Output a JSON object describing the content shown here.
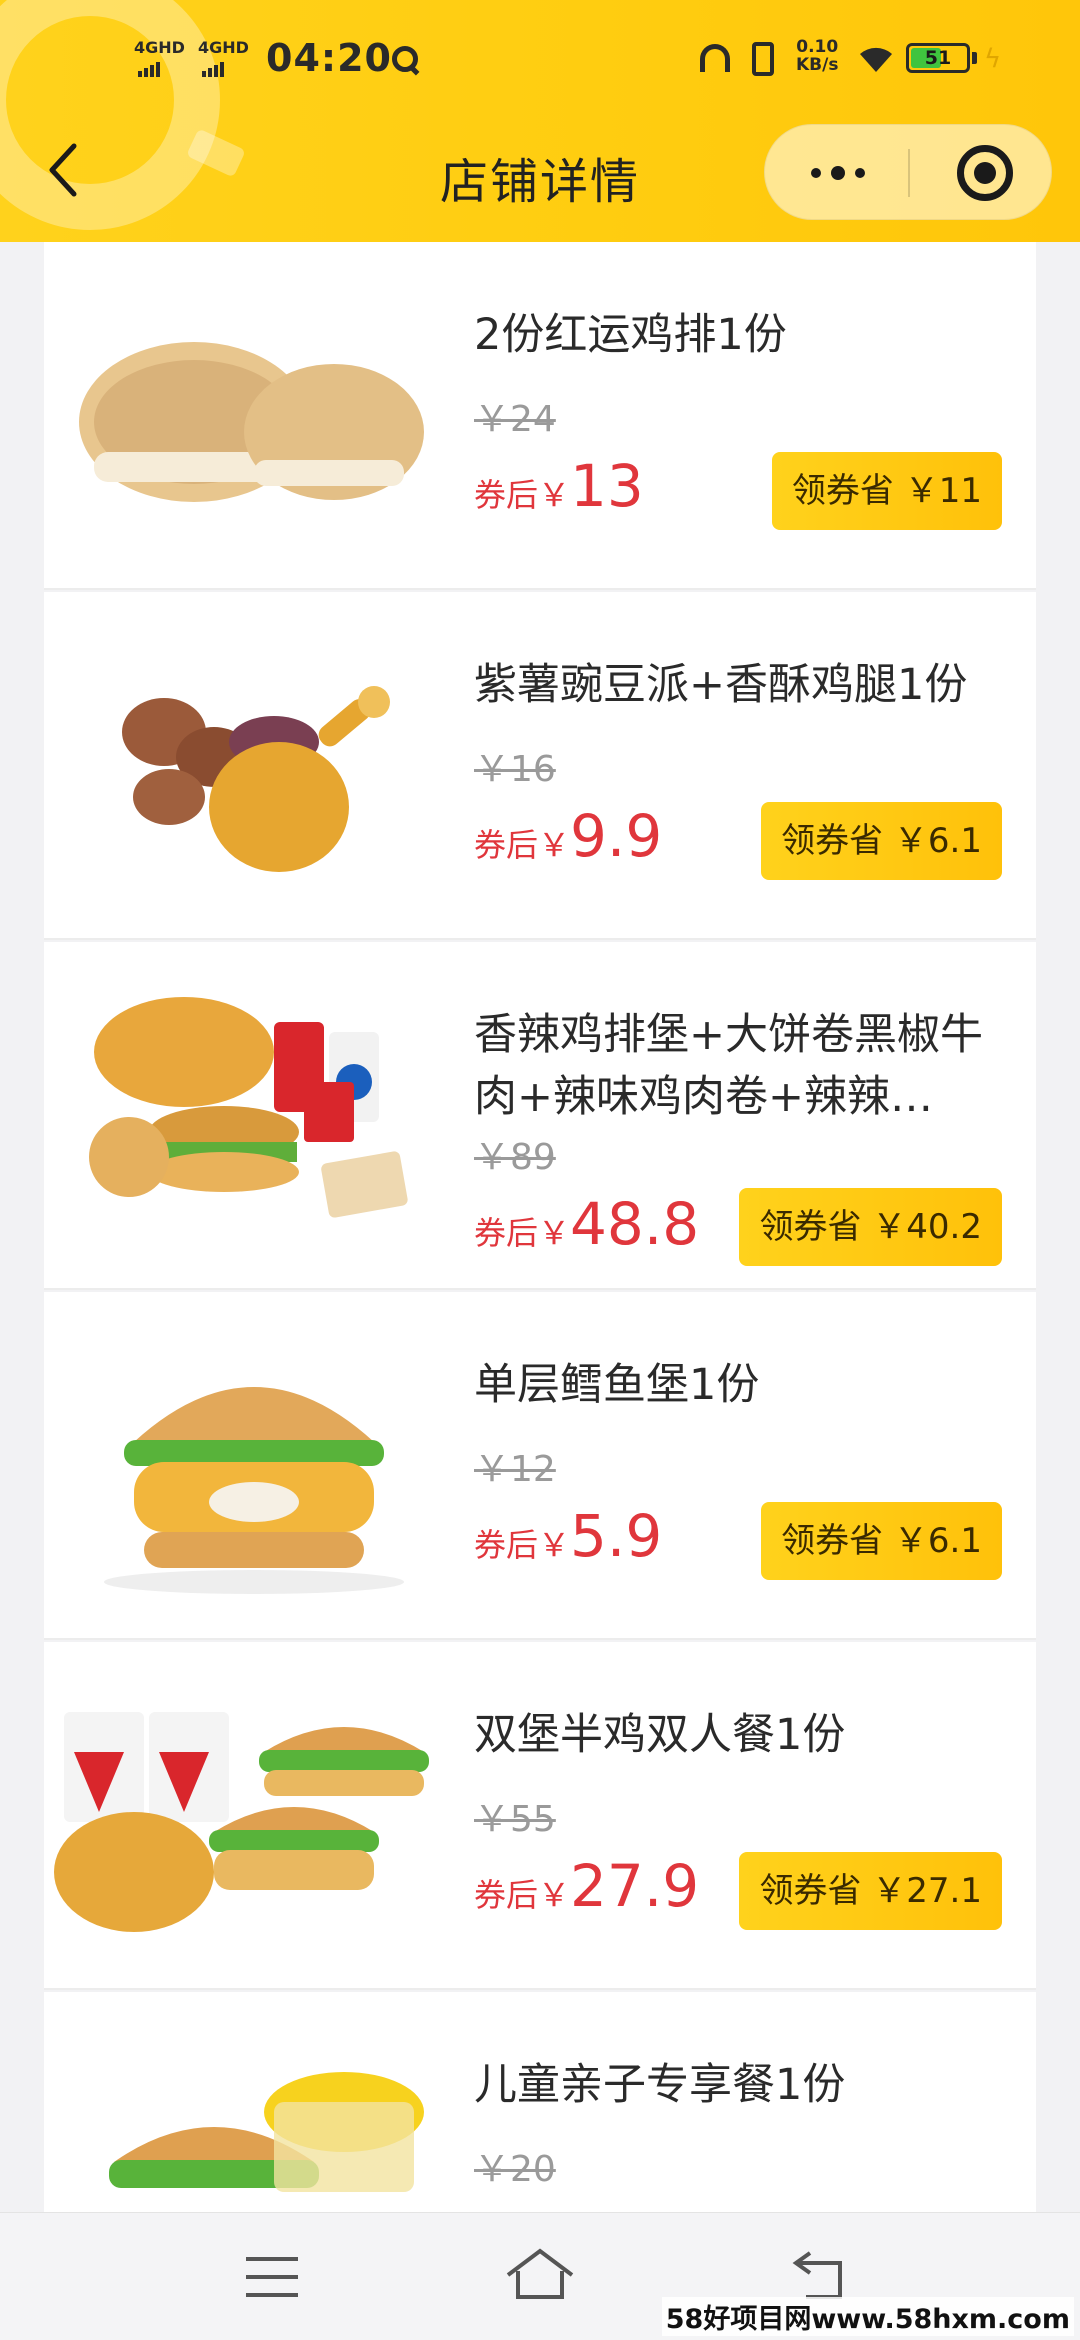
{
  "status_bar": {
    "signal1": "4GHD",
    "signal2": "4GHD",
    "time": "04:20",
    "net_speed_value": "0.10",
    "net_speed_unit": "KB/s",
    "battery_level": "51",
    "battery_fraction": 0.51,
    "battery_color": "#3fc43f"
  },
  "header": {
    "title": "店铺详情",
    "back_icon": "chevron-left-icon",
    "more_icon": "more-dots-icon",
    "close_icon": "target-close-icon",
    "brand_color": "#ffcd10"
  },
  "products": [
    {
      "name": "2份红运鸡排1份",
      "orig_price": "￥24",
      "after_label": "券后",
      "currency": "￥",
      "after_price": "13",
      "coupon": "领券省 ￥11"
    },
    {
      "name": "紫薯豌豆派+香酥鸡腿1份",
      "orig_price": "￥16",
      "after_label": "券后",
      "currency": "￥",
      "after_price": "9.9",
      "coupon": "领券省 ￥6.1"
    },
    {
      "name": "香辣鸡排堡+大饼卷黑椒牛肉+辣味鸡肉卷+辣辣…",
      "orig_price": "￥89",
      "after_label": "券后",
      "currency": "￥",
      "after_price": "48.8",
      "coupon": "领券省 ￥40.2"
    },
    {
      "name": "单层鳕鱼堡1份",
      "orig_price": "￥12",
      "after_label": "券后",
      "currency": "￥",
      "after_price": "5.9",
      "coupon": "领券省 ￥6.1"
    },
    {
      "name": "双堡半鸡双人餐1份",
      "orig_price": "￥55",
      "after_label": "券后",
      "currency": "￥",
      "after_price": "27.9",
      "coupon": "领券省 ￥27.1"
    },
    {
      "name": "儿童亲子专享餐1份",
      "orig_price": "￥20",
      "after_label": "",
      "currency": "",
      "after_price": "",
      "coupon": ""
    }
  ],
  "nav": {
    "menu_icon": "menu-icon",
    "home_icon": "home-icon",
    "back_icon": "return-icon"
  },
  "watermark": "58好项目网www.58hxm.com",
  "colors": {
    "price_red": "#e0363c",
    "coupon_yellow": "#ffc60a",
    "strike_gray": "#9a9a9a"
  }
}
